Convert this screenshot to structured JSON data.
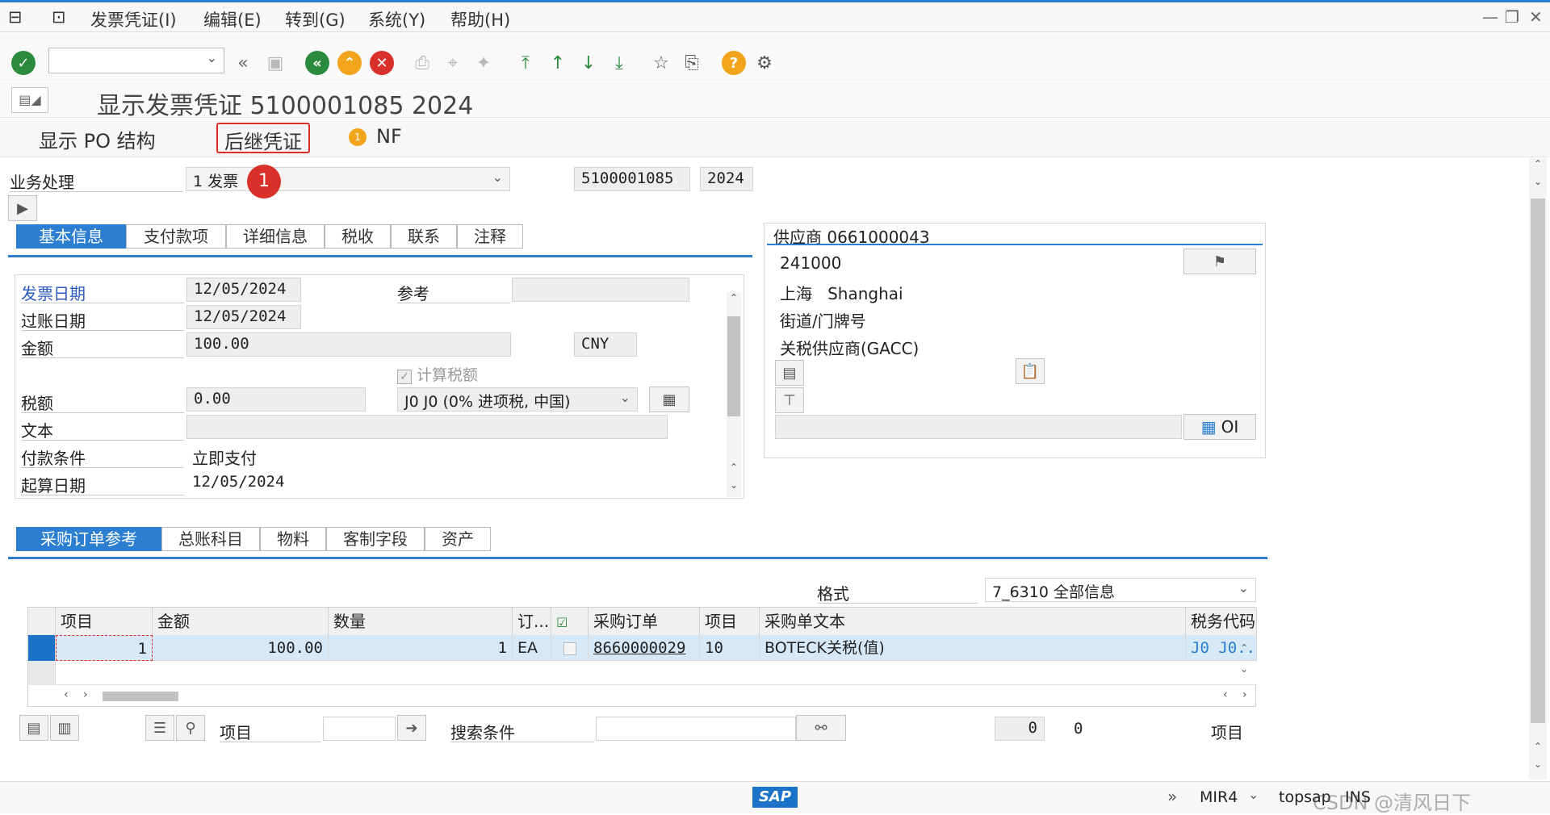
{
  "menubar": {
    "items": [
      "发票凭证(I)",
      "编辑(E)",
      "转到(G)",
      "系统(Y)",
      "帮助(H)"
    ]
  },
  "toolbar": {
    "command_field_value": ""
  },
  "title": {
    "text": "显示发票凭证 5100001085 2024"
  },
  "app_toolbar": {
    "po_structure": "显示 PO 结构",
    "follow_on_docs": "后继凭证",
    "nf": "NF"
  },
  "header": {
    "transaction_label": "业务处理",
    "transaction_value": "1 发票",
    "annotation_number": "1",
    "doc_number": "5100001085",
    "fiscal_year": "2024"
  },
  "tabs_top": [
    "基本信息",
    "支付款项",
    "详细信息",
    "税收",
    "联系",
    "注释"
  ],
  "basic_info": {
    "invoice_date_label": "发票日期",
    "invoice_date": "12/05/2024",
    "reference_label": "参考",
    "reference": "",
    "posting_date_label": "过账日期",
    "posting_date": "12/05/2024",
    "amount_label": "金额",
    "amount": "100.00",
    "currency": "CNY",
    "calc_tax_label": "计算税额",
    "tax_amount_label": "税额",
    "tax_amount": "0.00",
    "tax_code": "J0 J0 (0% 进项税, 中国)",
    "text_label": "文本",
    "text": "",
    "payment_terms_label": "付款条件",
    "payment_terms": "立即支付",
    "baseline_date_label": "起算日期",
    "baseline_date": "12/05/2024"
  },
  "vendor": {
    "title": "供应商 0661000043",
    "postal_code": "241000",
    "city_cn": "上海",
    "city_en": "Shanghai",
    "street": "街道/门牌号",
    "name": "关税供应商(GACC)",
    "oi_label": "OI"
  },
  "tabs_bottom": [
    "采购订单参考",
    "总账科目",
    "物料",
    "客制字段",
    "资产"
  ],
  "layout_section": {
    "format_label": "格式",
    "format_value": "7_6310 全部信息"
  },
  "po_table": {
    "headers": [
      "项目",
      "金额",
      "数量",
      "订...",
      "",
      "采购订单",
      "项目",
      "采购单文本",
      "税务代码"
    ],
    "rows": [
      {
        "item": "1",
        "amount": "100.00",
        "quantity": "1",
        "unit": "EA",
        "po_number": "8660000029",
        "po_item": "10",
        "po_text": "BOTECK关税(值)",
        "tax_code": "J0  J0..."
      }
    ]
  },
  "bottom_controls": {
    "item_label": "项目",
    "search_label": "搜索条件",
    "count_value": "0",
    "count_total": "0",
    "items_label": "项目"
  },
  "statusbar": {
    "sap_logo": "SAP",
    "transaction": "MIR4",
    "server": "topsap",
    "mode": "INS",
    "watermark": "CSDN @清风日下"
  },
  "colors": {
    "accent": "#2c7fd0",
    "green": "#2a8a3e",
    "orange": "#f2a51a",
    "red": "#d9302c",
    "highlight_row": "#d7e8f7"
  }
}
